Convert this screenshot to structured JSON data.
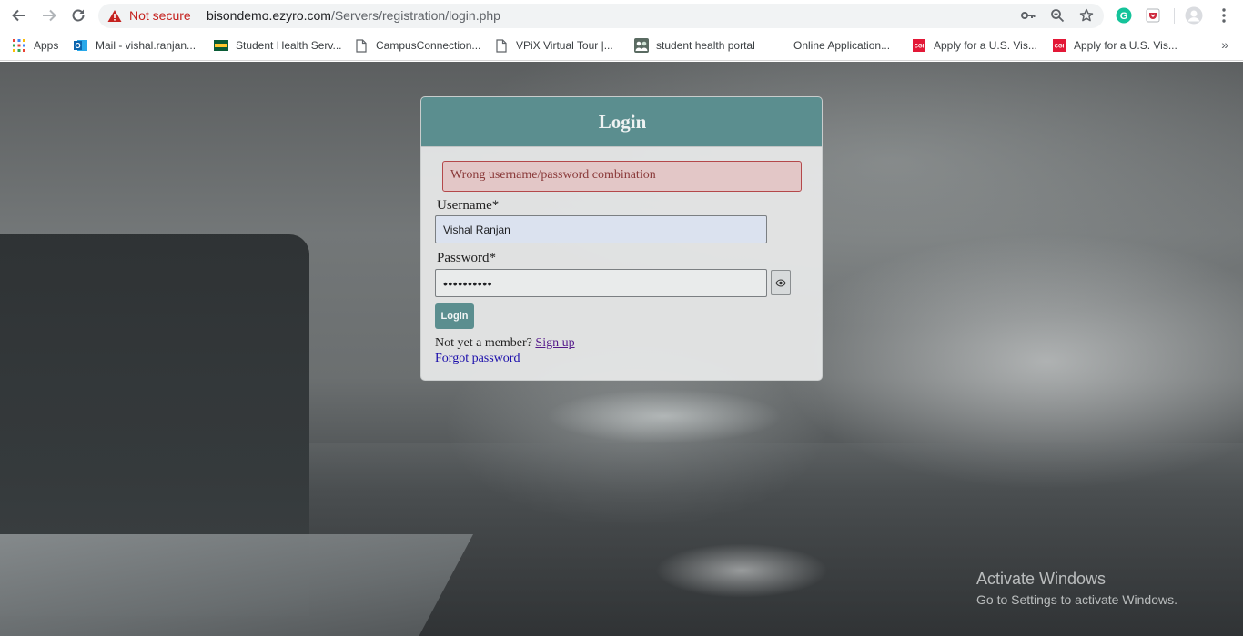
{
  "browser": {
    "security_label": "Not secure",
    "url_host": "bisondemo.ezyro.com",
    "url_path": "/Servers/registration/login.php"
  },
  "bookmarks": [
    {
      "label": "Apps",
      "icon": "apps-grid-icon"
    },
    {
      "label": "Mail - vishal.ranjan...",
      "icon": "outlook-icon"
    },
    {
      "label": "Student Health Serv...",
      "icon": "ndsu-icon"
    },
    {
      "label": "CampusConnection...",
      "icon": "page-icon"
    },
    {
      "label": "VPiX Virtual Tour |...",
      "icon": "page-icon"
    },
    {
      "label": "student health portal",
      "icon": "portal-icon"
    },
    {
      "label": "Online Application...",
      "icon": "none"
    },
    {
      "label": "Apply for a U.S. Vis...",
      "icon": "cgi-icon"
    },
    {
      "label": "Apply for a U.S. Vis...",
      "icon": "cgi-icon"
    }
  ],
  "login": {
    "title": "Login",
    "error_message": "Wrong username/password combination",
    "username_label": "Username*",
    "username_value": "Vishal Ranjan",
    "password_label": "Password*",
    "password_value": "••••••••••",
    "submit_label": "Login",
    "signup_prompt": "Not yet a member?",
    "signup_link": "Sign up",
    "forgot_link": "Forgot password"
  },
  "watermark": {
    "title": "Activate Windows",
    "subtitle": "Go to Settings to activate Windows."
  },
  "colors": {
    "header": "#5b8e8f",
    "error_border": "#b4484a",
    "not_secure": "#c5221f"
  }
}
